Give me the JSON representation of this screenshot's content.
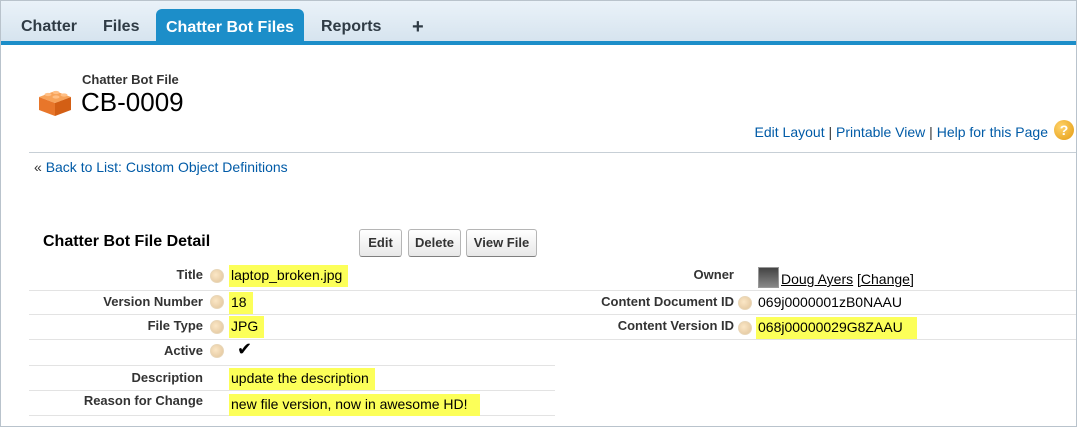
{
  "tabs": [
    {
      "label": "Chatter",
      "active": false
    },
    {
      "label": "Files",
      "active": false
    },
    {
      "label": "Chatter Bot Files",
      "active": true
    },
    {
      "label": "Reports",
      "active": false
    },
    {
      "label": "+",
      "active": false
    }
  ],
  "header": {
    "object_type": "Chatter Bot File",
    "record_name": "CB-0009",
    "icon": "orange-block-icon"
  },
  "links": {
    "edit_layout": "Edit Layout",
    "sep1": "|",
    "printable_view": "Printable View",
    "sep2": "|",
    "help": "Help for this Page",
    "help_icon": "?"
  },
  "back": {
    "prefix": "«",
    "label": "Back to List: Custom Object Definitions"
  },
  "detail": {
    "title": "Chatter Bot File Detail",
    "buttons": {
      "edit": "Edit",
      "delete": "Delete",
      "view_file": "View File"
    }
  },
  "fields": {
    "title": {
      "label": "Title",
      "value": "laptop_broken.jpg"
    },
    "version_number": {
      "label": "Version Number",
      "value": "18"
    },
    "file_type": {
      "label": "File Type",
      "value": "JPG"
    },
    "active": {
      "label": "Active",
      "value": "✔"
    },
    "description": {
      "label": "Description",
      "value": "update the description"
    },
    "reason_for_change": {
      "label": "Reason for Change",
      "value": "new file version, now in awesome HD!"
    },
    "owner": {
      "label": "Owner",
      "value": "Doug Ayers",
      "change": "[Change]"
    },
    "content_document_id": {
      "label": "Content Document ID",
      "value": "069j0000001zB0NAAU"
    },
    "content_version_id": {
      "label": "Content Version ID",
      "value": "068j00000029G8ZAAU"
    }
  },
  "colors": {
    "accent": "#1c8ec9",
    "highlight": "#fcff59",
    "link": "#015ba7"
  }
}
